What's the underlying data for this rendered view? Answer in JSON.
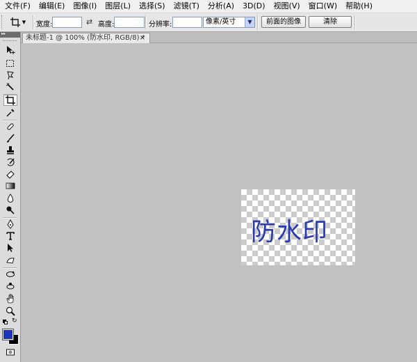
{
  "menu": [
    {
      "id": "file",
      "label": "文件(F)"
    },
    {
      "id": "edit",
      "label": "编辑(E)"
    },
    {
      "id": "image",
      "label": "图像(I)"
    },
    {
      "id": "layer",
      "label": "图层(L)"
    },
    {
      "id": "select",
      "label": "选择(S)"
    },
    {
      "id": "filter",
      "label": "滤镜(T)"
    },
    {
      "id": "analysis",
      "label": "分析(A)"
    },
    {
      "id": "3d",
      "label": "3D(D)"
    },
    {
      "id": "view",
      "label": "视图(V)"
    },
    {
      "id": "window",
      "label": "窗口(W)"
    },
    {
      "id": "help",
      "label": "帮助(H)"
    }
  ],
  "options": {
    "width_label": "宽度:",
    "width_value": "",
    "height_label": "高度:",
    "height_value": "",
    "resolution_label": "分辨率:",
    "resolution_value": "",
    "unit_select": "像素/英寸",
    "front_image_button": "前面的图像",
    "clear_button": "清除"
  },
  "document": {
    "tab_title": "未标题-1 @ 100% (防水印, RGB/8) *",
    "close_glyph": "×",
    "watermark_text": "防水印"
  },
  "colors": {
    "foreground": "#1f37b5",
    "background": "#000000",
    "workspace": "#c1c1c1",
    "watermark": "#2a3bb0"
  },
  "tools": [
    {
      "name": "move-tool-icon"
    },
    {
      "name": "marquee-tool-icon"
    },
    {
      "name": "lasso-tool-icon"
    },
    {
      "name": "quick-select-tool-icon"
    },
    {
      "name": "crop-tool-icon",
      "active": true
    },
    {
      "name": "eyedropper-tool-icon"
    },
    {
      "name": "healing-brush-tool-icon"
    },
    {
      "name": "brush-tool-icon"
    },
    {
      "name": "clone-stamp-tool-icon"
    },
    {
      "name": "history-brush-tool-icon"
    },
    {
      "name": "eraser-tool-icon"
    },
    {
      "name": "gradient-tool-icon"
    },
    {
      "name": "blur-tool-icon"
    },
    {
      "name": "dodge-tool-icon"
    },
    {
      "name": "pen-tool-icon"
    },
    {
      "name": "type-tool-icon"
    },
    {
      "name": "path-select-tool-icon"
    },
    {
      "name": "shape-tool-icon"
    },
    {
      "name": "3d-rotate-tool-icon"
    },
    {
      "name": "3d-orbit-tool-icon"
    },
    {
      "name": "hand-tool-icon"
    },
    {
      "name": "zoom-tool-icon"
    },
    {
      "name": "quick-mask-icon"
    }
  ]
}
